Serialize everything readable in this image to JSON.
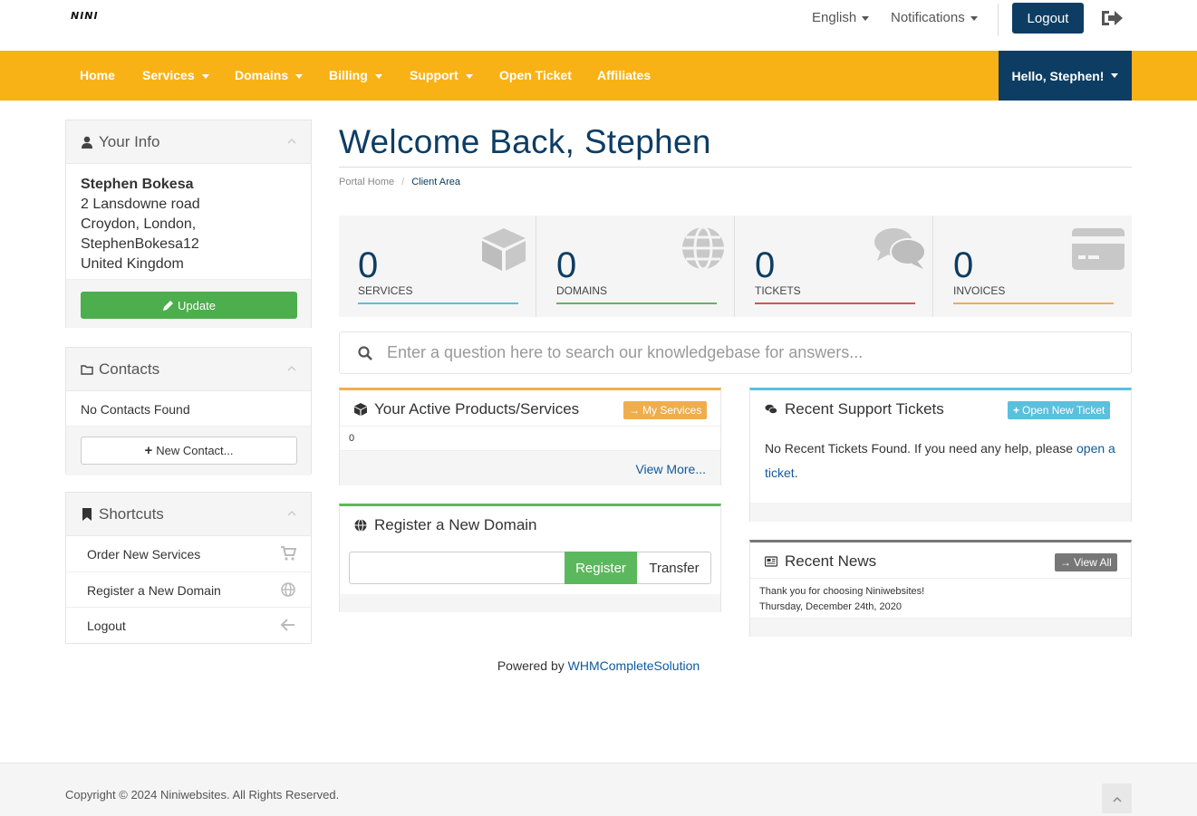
{
  "header": {
    "logo": "NINI",
    "language": "English",
    "notifications": "Notifications",
    "logout": "Logout"
  },
  "nav": {
    "items": [
      "Home",
      "Services",
      "Domains",
      "Billing",
      "Support",
      "Open Ticket",
      "Affiliates"
    ],
    "greeting": "Hello, Stephen!"
  },
  "sidebar": {
    "your_info": {
      "title": "Your Info",
      "name": "Stephen Bokesa",
      "address1": "2 Lansdowne road",
      "address2": "Croydon, London,",
      "address3": "StephenBokesa12",
      "country": "United Kingdom",
      "update": "Update"
    },
    "contacts": {
      "title": "Contacts",
      "empty": "No Contacts Found",
      "new_contact": "New Contact..."
    },
    "shortcuts": {
      "title": "Shortcuts",
      "items": [
        "Order New Services",
        "Register a New Domain",
        "Logout"
      ]
    }
  },
  "main": {
    "title": "Welcome Back, Stephen",
    "breadcrumb": [
      "Portal Home",
      "Client Area"
    ],
    "stats": [
      {
        "value": "0",
        "label": "SERVICES",
        "color": "#5bc0de"
      },
      {
        "value": "0",
        "label": "DOMAINS",
        "color": "#5cb85c"
      },
      {
        "value": "0",
        "label": "TICKETS",
        "color": "#d9534f"
      },
      {
        "value": "0",
        "label": "INVOICES",
        "color": "#f0ad4e"
      }
    ],
    "kb_placeholder": "Enter a question here to search our knowledgebase for answers...",
    "products": {
      "title": "Your Active Products/Services",
      "badge": "My Services",
      "count": "0",
      "view_more": "View More..."
    },
    "domain": {
      "title": "Register a New Domain",
      "input_value": "",
      "register": "Register",
      "transfer": "Transfer"
    },
    "tickets": {
      "title": "Recent Support Tickets",
      "badge": "Open New Ticket",
      "text": "No Recent Tickets Found. If you need any help, please",
      "link": "open a ticket",
      "period": "."
    },
    "news": {
      "title": "Recent News",
      "badge": "View All",
      "headline": "Thank you for choosing Niniwebsites!",
      "date": "Thursday, December 24th, 2020"
    }
  },
  "footer": {
    "powered_prefix": "Powered by",
    "powered_link": "WHMCompleteSolution",
    "copyright": "Copyright © 2024 Niniwebsites. All Rights Reserved."
  },
  "colors": {
    "brand_dark": "#0e3d63",
    "nav_yellow": "#f9b216",
    "success": "#4cae4c"
  }
}
